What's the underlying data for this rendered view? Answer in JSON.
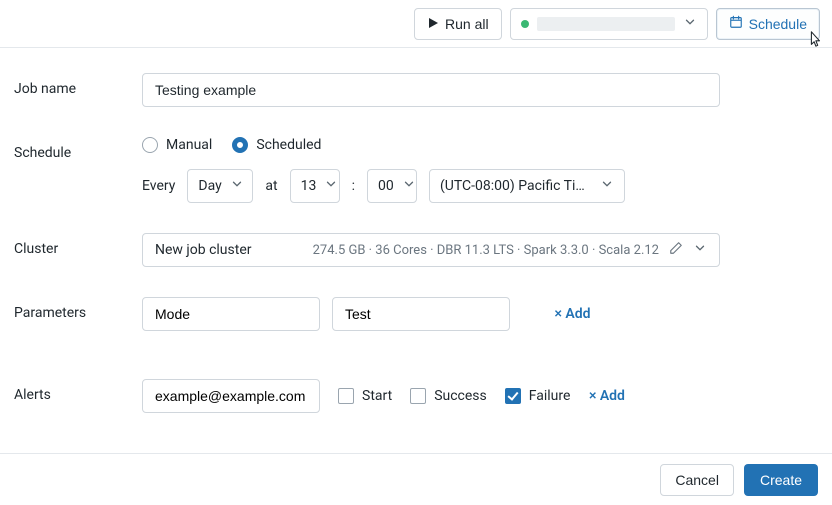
{
  "toolbar": {
    "runall_label": "Run all",
    "schedule_label": "Schedule"
  },
  "form": {
    "jobname_label": "Job name",
    "jobname_value": "Testing example",
    "schedule_label": "Schedule",
    "radio_manual": "Manual",
    "radio_scheduled": "Scheduled",
    "schedule_mode": "scheduled",
    "every_word": "Every",
    "interval_value": "Day",
    "at_word": "at",
    "hour_value": "13",
    "min_value": "00",
    "tz_value": "(UTC-08:00) Pacific Ti…",
    "cluster_label": "Cluster",
    "cluster_name": "New job cluster",
    "cluster_stats": "274.5 GB · 36 Cores · DBR 11.3 LTS · Spark 3.3.0 · Scala 2.12",
    "params_label": "Parameters",
    "param_key": "Mode",
    "param_value": "Test",
    "add_param": "Add",
    "alerts_label": "Alerts",
    "alert_email": "example@example.com",
    "alert_start": "Start",
    "alert_success": "Success",
    "alert_failure": "Failure",
    "alert_checks": {
      "start": false,
      "success": false,
      "failure": true
    },
    "add_alert": "Add"
  },
  "footer": {
    "cancel": "Cancel",
    "create": "Create"
  }
}
